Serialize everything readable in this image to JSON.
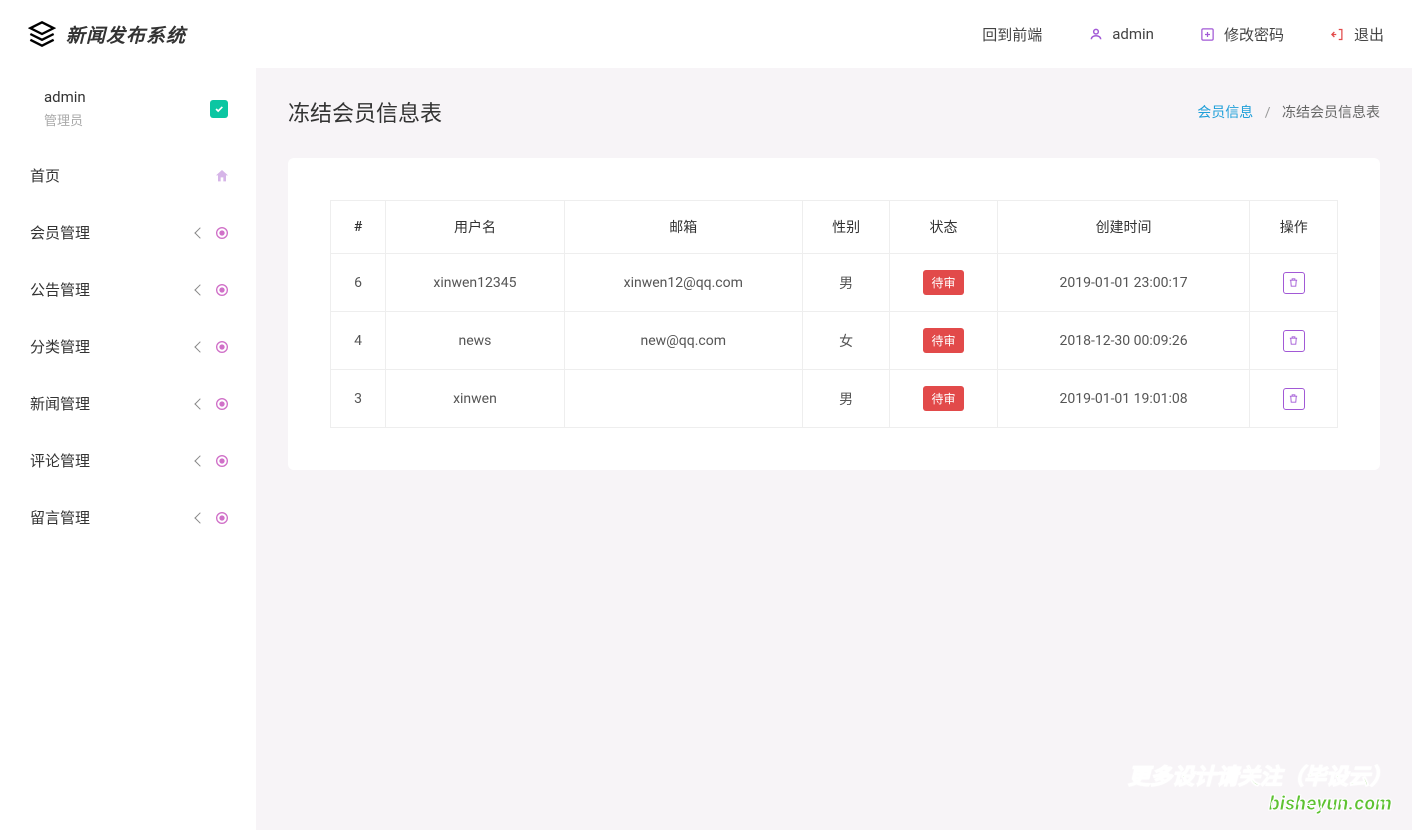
{
  "brand": "新闻发布系统",
  "topnav": {
    "back_frontend": "回到前端",
    "user_label": "admin",
    "change_pw": "修改密码",
    "logout": "退出"
  },
  "sidebar": {
    "user": {
      "name": "admin",
      "role": "管理员"
    },
    "items": [
      {
        "label": "首页",
        "type": "home"
      },
      {
        "label": "会员管理",
        "type": "expand"
      },
      {
        "label": "公告管理",
        "type": "expand"
      },
      {
        "label": "分类管理",
        "type": "expand"
      },
      {
        "label": "新闻管理",
        "type": "expand"
      },
      {
        "label": "评论管理",
        "type": "expand"
      },
      {
        "label": "留言管理",
        "type": "expand"
      }
    ]
  },
  "page": {
    "title": "冻结会员信息表",
    "breadcrumb_link": "会员信息",
    "breadcrumb_current": "冻结会员信息表"
  },
  "table": {
    "headers": [
      "#",
      "用户名",
      "邮箱",
      "性别",
      "状态",
      "创建时间",
      "操作"
    ],
    "rows": [
      {
        "id": "6",
        "username": "xinwen12345",
        "email": "xinwen12@qq.com",
        "gender": "男",
        "status": "待审",
        "created": "2019-01-01 23:00:17"
      },
      {
        "id": "4",
        "username": "news",
        "email": "new@qq.com",
        "gender": "女",
        "status": "待审",
        "created": "2018-12-30 00:09:26"
      },
      {
        "id": "3",
        "username": "xinwen",
        "email": "",
        "gender": "男",
        "status": "待审",
        "created": "2019-01-01 19:01:08"
      }
    ]
  },
  "watermark": {
    "line1": "更多设计请关注（毕设云）",
    "line2": "bisheyun.com"
  }
}
